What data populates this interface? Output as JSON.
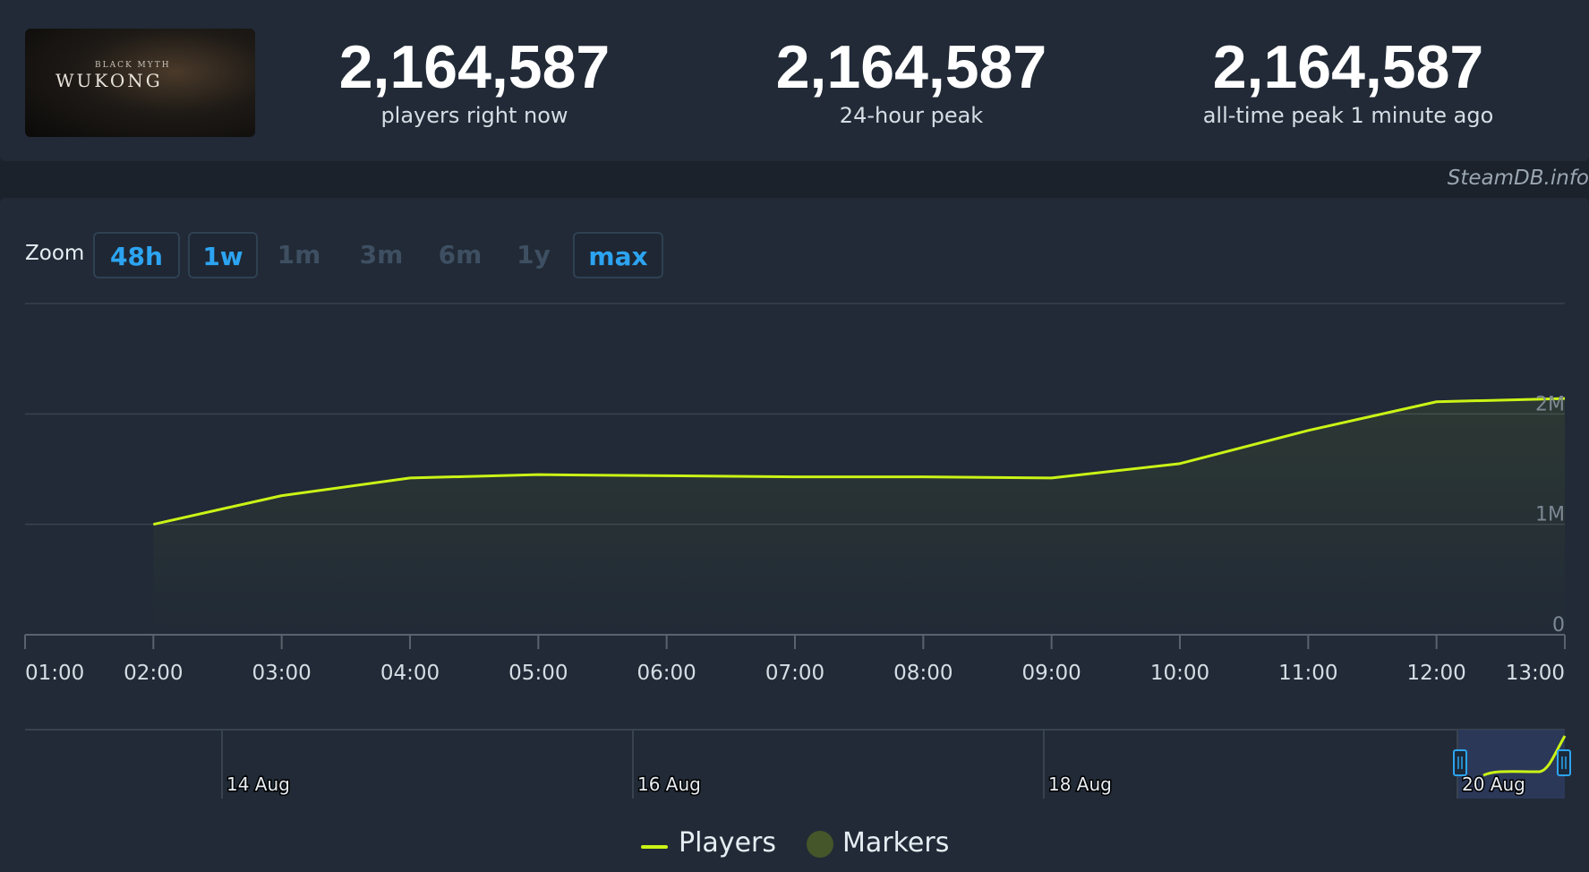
{
  "header": {
    "logo": {
      "small_text": "BLACK MYTH",
      "big_text": "WUKONG"
    },
    "stats": [
      {
        "value": "2,164,587",
        "label": "players right now"
      },
      {
        "value": "2,164,587",
        "label": "24-hour peak"
      },
      {
        "value": "2,164,587",
        "label": "all-time peak 1 minute ago"
      }
    ]
  },
  "credit": "SteamDB.info",
  "zoom": {
    "label": "Zoom",
    "buttons": [
      {
        "label": "48h",
        "state": "active"
      },
      {
        "label": "1w",
        "state": "active"
      },
      {
        "label": "1m",
        "state": "disabled"
      },
      {
        "label": "3m",
        "state": "disabled"
      },
      {
        "label": "6m",
        "state": "disabled"
      },
      {
        "label": "1y",
        "state": "disabled"
      },
      {
        "label": "max",
        "state": "active"
      }
    ]
  },
  "legend": [
    {
      "label": "Players",
      "symbol": "line",
      "color": "#cbf316"
    },
    {
      "label": "Markers",
      "symbol": "circle",
      "color": "#44562a"
    }
  ],
  "chart_data": {
    "type": "line",
    "title": "",
    "xlabel": "",
    "ylabel": "",
    "x_ticks": [
      "01:00",
      "02:00",
      "03:00",
      "04:00",
      "05:00",
      "06:00",
      "07:00",
      "08:00",
      "09:00",
      "10:00",
      "11:00",
      "12:00",
      "13:00"
    ],
    "x_range": [
      "01:00",
      "13:00"
    ],
    "y_ticks": [
      {
        "value": 0,
        "label": "0"
      },
      {
        "value": 1000000,
        "label": "1M"
      },
      {
        "value": 2000000,
        "label": "2M"
      }
    ],
    "ylim": [
      0,
      3000000
    ],
    "grid": true,
    "series": [
      {
        "name": "Players",
        "color": "#cbf316",
        "x": [
          "02:00",
          "03:00",
          "04:00",
          "05:00",
          "06:00",
          "07:00",
          "08:00",
          "09:00",
          "10:00",
          "11:00",
          "12:00",
          "13:00"
        ],
        "values": [
          1000000,
          1260000,
          1420000,
          1450000,
          1440000,
          1430000,
          1430000,
          1420000,
          1550000,
          1850000,
          2110000,
          2140000
        ]
      }
    ],
    "navigator": {
      "labels": [
        "14 Aug",
        "16 Aug",
        "18 Aug",
        "20 Aug"
      ]
    }
  }
}
